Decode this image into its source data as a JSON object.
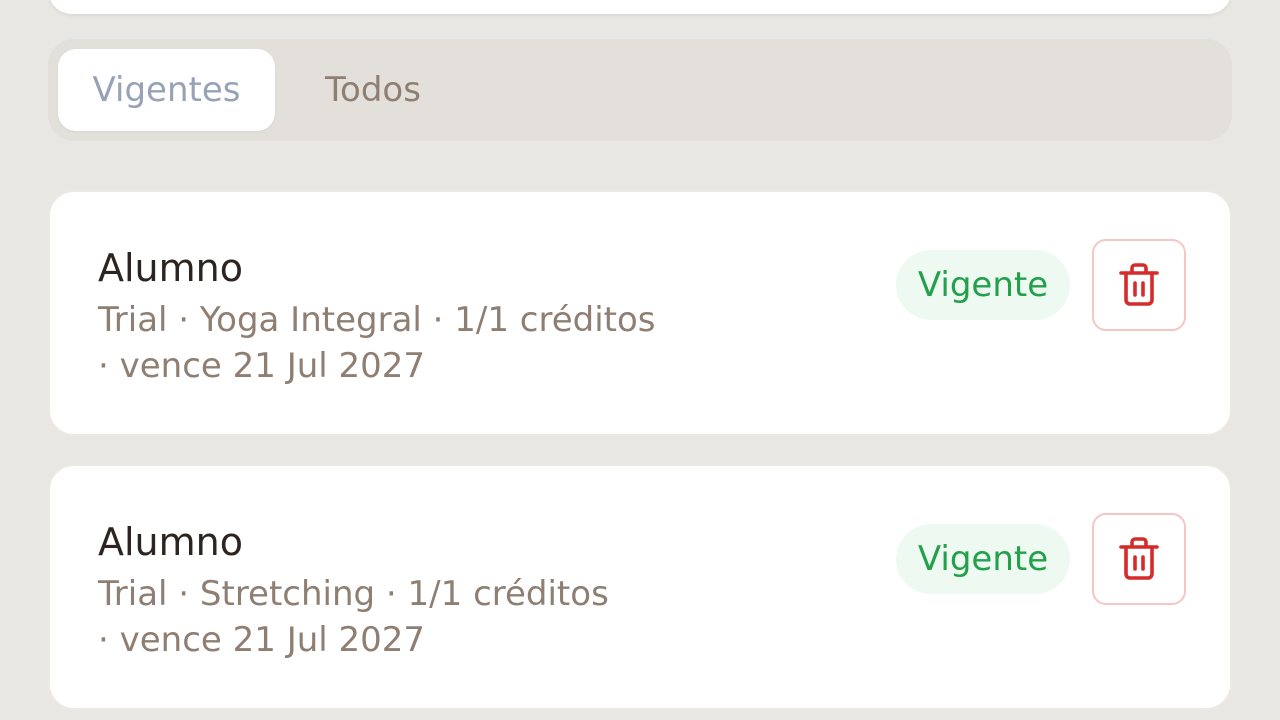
{
  "tabs": {
    "active_label": "Vigentes",
    "other_label": "Todos"
  },
  "items": [
    {
      "title": "Alumno",
      "line1": "Trial · Yoga Integral · 1/1 créditos",
      "line2": "· vence 21 Jul 2027",
      "status": "Vigente",
      "icon": "trash-icon"
    },
    {
      "title": "Alumno",
      "line1": "Trial · Stretching · 1/1 créditos",
      "line2": "· vence 21 Jul 2027",
      "status": "Vigente",
      "icon": "trash-icon"
    }
  ],
  "colors": {
    "background": "#e9e7e3",
    "tab_active_text": "#97a2b6",
    "tab_inactive_text": "#8f7f73",
    "status_text": "#22a04a",
    "status_bg": "#eefaf1",
    "delete_icon": "#d62b2b",
    "delete_border": "#f6c6c6"
  }
}
